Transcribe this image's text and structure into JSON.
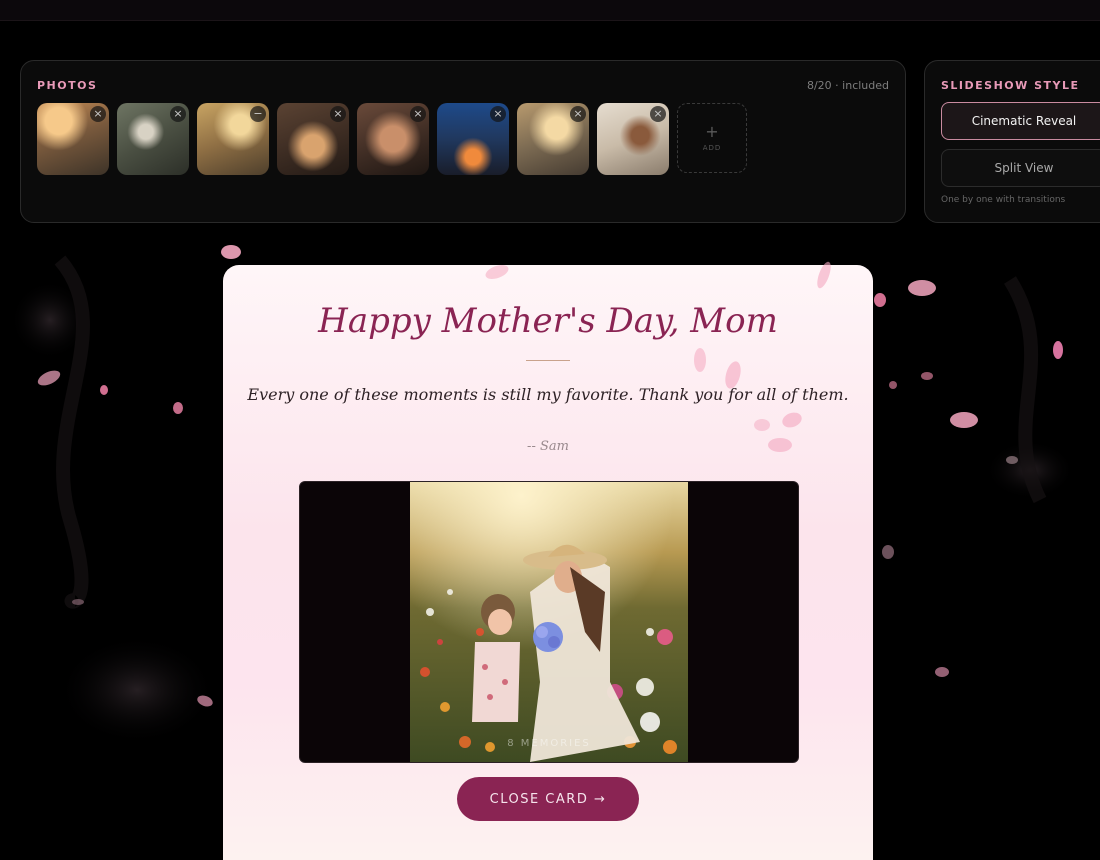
{
  "photos": {
    "title": "PHOTOS",
    "count": "8/20 · included",
    "thumbnails": [
      {
        "remove": "×"
      },
      {
        "remove": "×"
      },
      {
        "remove": "−"
      },
      {
        "remove": "×"
      },
      {
        "remove": "×"
      },
      {
        "remove": "×"
      },
      {
        "remove": "×"
      },
      {
        "remove": "×"
      }
    ],
    "add": {
      "icon": "+",
      "label": "ADD"
    }
  },
  "slideshow_style": {
    "title": "SLIDESHOW STYLE",
    "options": [
      {
        "label": "Cinematic Reveal",
        "selected": true
      },
      {
        "label": "Split View",
        "selected": false
      }
    ],
    "caption": "One by one with transitions"
  },
  "card": {
    "title": "Happy Mother's Day, Mom",
    "message": "Every one of these moments is still my favorite. Thank you for all of them.",
    "signature": "-- Sam",
    "memories_label": "8 MEMORIES",
    "close_button": "CLOSE CARD →"
  },
  "colors": {
    "accent": "#8a2453",
    "panel_title": "#e89ab8",
    "card_bg": "#fce4ec",
    "petal": "#f4a7c0"
  }
}
